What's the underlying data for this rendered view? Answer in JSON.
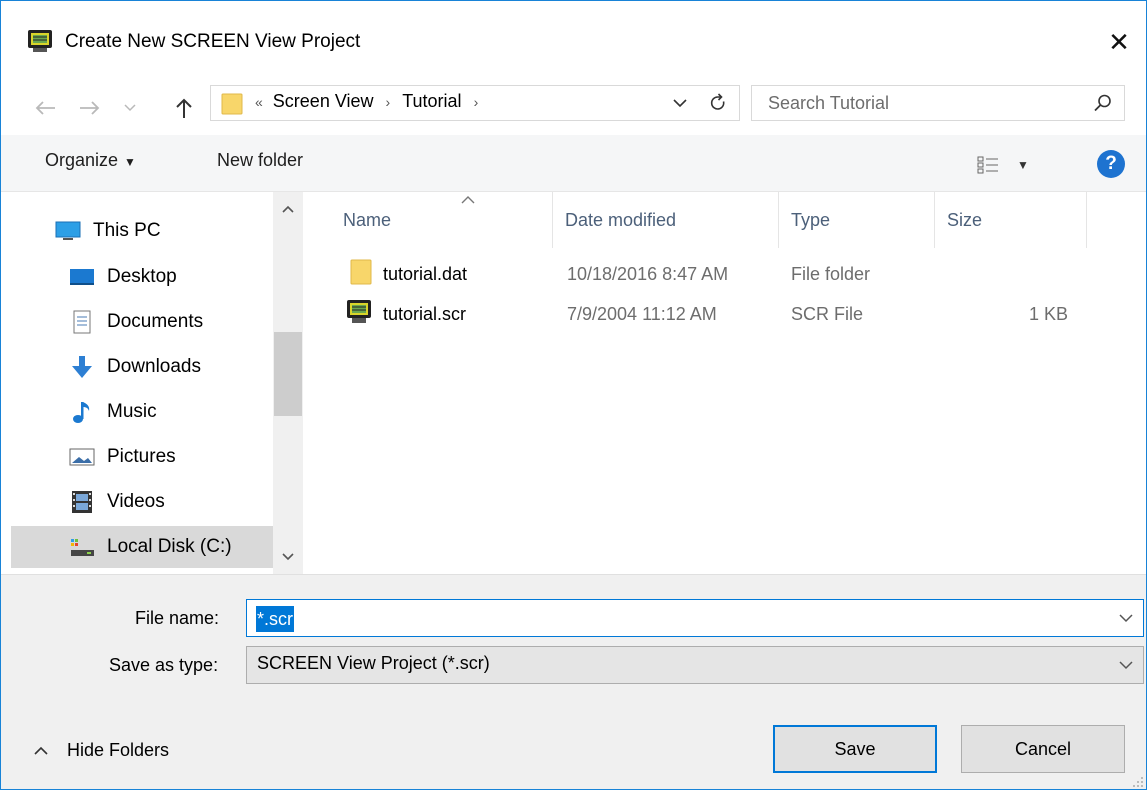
{
  "window": {
    "title": "Create New SCREEN View Project",
    "close_glyph": "✕"
  },
  "nav": {
    "breadcrumb_prefix": "«",
    "breadcrumbs": [
      "Screen View",
      "Tutorial"
    ],
    "search_placeholder": "Search Tutorial"
  },
  "toolbar": {
    "organize_label": "Organize",
    "new_folder_label": "New folder",
    "help_glyph": "?"
  },
  "sidebar": {
    "items": [
      {
        "label": "This PC",
        "icon": "monitor-icon"
      },
      {
        "label": "Desktop",
        "icon": "desktop-icon"
      },
      {
        "label": "Documents",
        "icon": "documents-icon"
      },
      {
        "label": "Downloads",
        "icon": "downloads-icon"
      },
      {
        "label": "Music",
        "icon": "music-icon"
      },
      {
        "label": "Pictures",
        "icon": "pictures-icon"
      },
      {
        "label": "Videos",
        "icon": "videos-icon"
      },
      {
        "label": "Local Disk (C:)",
        "icon": "drive-icon",
        "selected": true
      }
    ]
  },
  "filelist": {
    "columns": {
      "name": "Name",
      "date": "Date modified",
      "type": "Type",
      "size": "Size"
    },
    "rows": [
      {
        "name": "tutorial.dat",
        "date": "10/18/2016 8:47 AM",
        "type": "File folder",
        "size": "",
        "icon": "folder-icon"
      },
      {
        "name": "tutorial.scr",
        "date": "7/9/2004 11:12 AM",
        "type": "SCR File",
        "size": "1 KB",
        "icon": "scr-file-icon"
      }
    ]
  },
  "form": {
    "file_name_label": "File name:",
    "file_name_value": "*.scr",
    "save_type_label": "Save as type:",
    "save_type_value": "SCREEN View Project (*.scr)"
  },
  "footer": {
    "hide_folders_label": "Hide Folders",
    "save_label": "Save",
    "cancel_label": "Cancel"
  },
  "colors": {
    "accent": "#0078d7",
    "help_blue": "#1e73d0",
    "folder_yellow": "#f8d66a"
  }
}
